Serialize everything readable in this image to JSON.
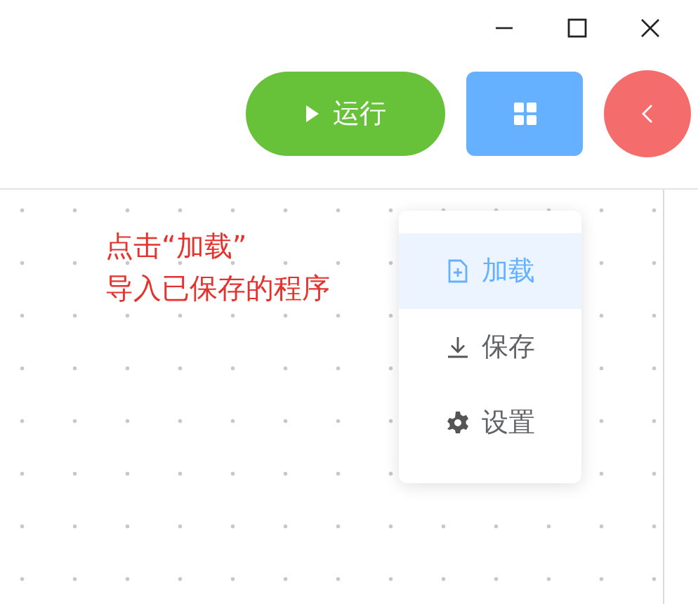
{
  "toolbar": {
    "run_button": {
      "label": "运行"
    }
  },
  "annotation": {
    "lines": [
      "点击“加载”",
      "导入已保存的程序"
    ]
  },
  "menu": {
    "items": [
      {
        "label": "加载",
        "kind": "load",
        "selected": true
      },
      {
        "label": "保存",
        "kind": "save",
        "selected": false
      },
      {
        "label": "设置",
        "kind": "settings",
        "selected": false
      }
    ]
  }
}
